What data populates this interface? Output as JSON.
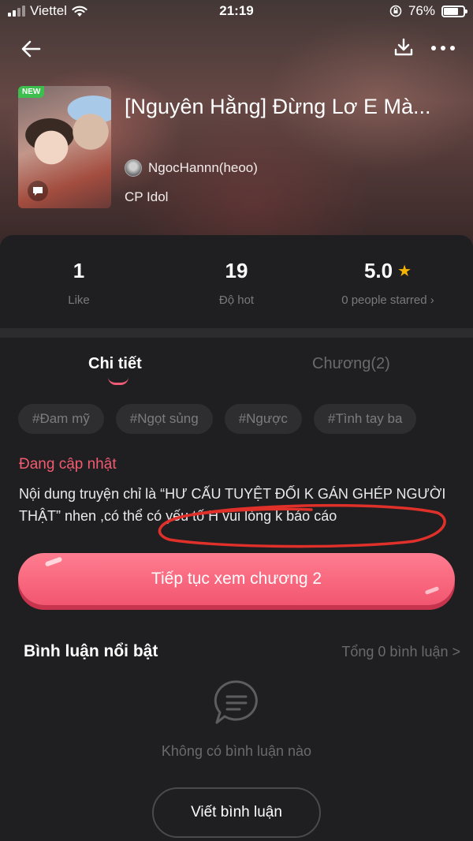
{
  "status_bar": {
    "carrier": "Viettel",
    "time": "21:19",
    "battery": "76%",
    "battery_level": 0.76
  },
  "book": {
    "title": "[Nguyên Hằng] Đừng Lơ E Mà...",
    "badge": "NEW",
    "author": "NgocHannn(heoo)",
    "category": "CP Idol"
  },
  "stats": {
    "likes": {
      "value": "1",
      "label": "Like"
    },
    "hot": {
      "value": "19",
      "label": "Độ hot"
    },
    "rating": {
      "value": "5.0",
      "label": "0 people starred ›"
    }
  },
  "tabs": {
    "details": "Chi tiết",
    "chapters": "Chương(2)"
  },
  "tags": [
    "#Đam mỹ",
    "#Ngọt sủng",
    "#Ngược",
    "#Tình tay ba"
  ],
  "update_status": "Đang cập nhật",
  "description": "Nội dung truyện chỉ là “HƯ CẤU TUYỆT ĐỐI K GÁN GHÉP NGƯỜI THẬT” nhen ,có thể có yếu tố H vui lòng k báo cáo",
  "continue_button": "Tiếp tục xem chương 2",
  "comments": {
    "title": "Bình luận nổi bật",
    "total": "Tổng 0 bình luận >",
    "empty": "Không có bình luận nào",
    "write_button": "Viết bình luận"
  },
  "colors": {
    "accent": "#f25670",
    "background": "#1f1f21",
    "star": "#f4b400"
  }
}
